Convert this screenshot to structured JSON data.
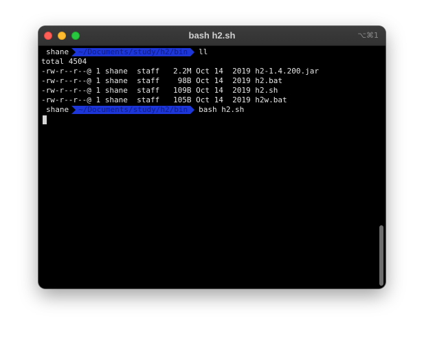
{
  "window": {
    "title": "bash h2.sh",
    "shortcut": "⌥⌘1"
  },
  "prompt": {
    "user": "shane",
    "path": "~/Documents/study/h2/bin"
  },
  "commands": {
    "first": "ll",
    "second": "bash h2.sh"
  },
  "output": {
    "total": "total 4504",
    "files": [
      "-rw-r--r--@ 1 shane  staff   2.2M Oct 14  2019 h2-1.4.200.jar",
      "-rw-r--r--@ 1 shane  staff    98B Oct 14  2019 h2.bat",
      "-rw-r--r--@ 1 shane  staff   109B Oct 14  2019 h2.sh",
      "-rw-r--r--@ 1 shane  staff   105B Oct 14  2019 h2w.bat"
    ]
  }
}
